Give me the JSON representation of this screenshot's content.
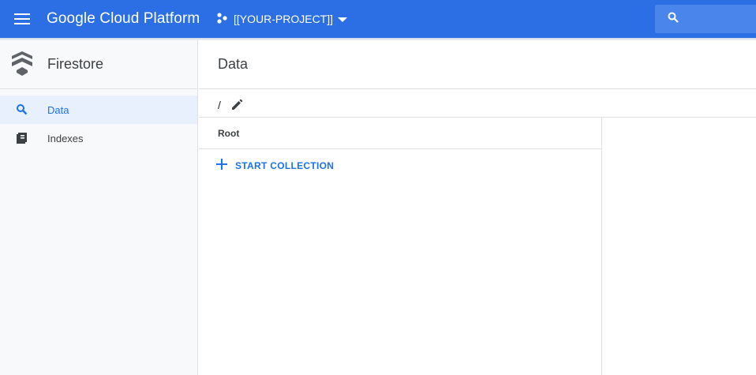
{
  "topbar": {
    "brand": "Google Cloud Platform",
    "project_name": "[[YOUR-PROJECT]]",
    "menu_icon": "hamburger-menu-icon",
    "project_icon": "project-hub-icon",
    "search_icon": "search-icon",
    "color": "#2c6fe4"
  },
  "sidebar": {
    "product_title": "Firestore",
    "product_icon": "firestore-icon",
    "items": [
      {
        "label": "Data",
        "icon": "search-icon",
        "active": true
      },
      {
        "label": "Indexes",
        "icon": "indexes-icon",
        "active": false
      }
    ]
  },
  "main": {
    "title": "Data",
    "path": "/",
    "edit_icon": "pencil-icon",
    "root_panel": {
      "title": "Root",
      "start_collection_label": "START COLLECTION",
      "add_icon": "plus-icon"
    }
  },
  "colors": {
    "accent": "#1a73e8",
    "sidebar_bg": "#f8f9fa",
    "active_bg": "#e8f0fe"
  }
}
